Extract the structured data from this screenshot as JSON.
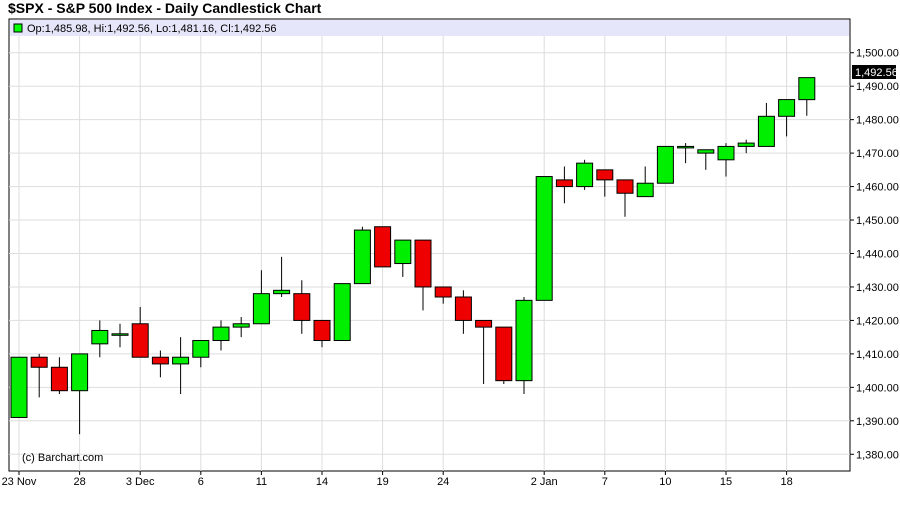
{
  "title": "$SPX - S&P 500 Index - Daily Candlestick Chart",
  "legend": {
    "ohlc_text": "Op:1,485.98, Hi:1,492.56, Lo:1,481.16, Cl:1,492.56",
    "color": "#00ff00"
  },
  "watermark": "(c) Barchart.com",
  "last_price_label": "1,492.56",
  "colors": {
    "up": "#00ee00",
    "down": "#ee0000",
    "legend_band": "#e6e6fa",
    "grid": "#dddddd"
  },
  "chart_data": {
    "type": "candlestick",
    "ylim": [
      1375,
      1505
    ],
    "y_ticks": [
      1380,
      1390,
      1400,
      1410,
      1420,
      1430,
      1440,
      1450,
      1460,
      1470,
      1480,
      1490,
      1500
    ],
    "y_tick_labels": [
      "1,380.00",
      "1,390.00",
      "1,400.00",
      "1,410.00",
      "1,420.00",
      "1,430.00",
      "1,440.00",
      "1,450.00",
      "1,460.00",
      "1,470.00",
      "1,480.00",
      "1,490.00",
      "1,500.00"
    ],
    "x_tick_labels": [
      {
        "index": 0,
        "label": "23 Nov"
      },
      {
        "index": 3,
        "label": "28"
      },
      {
        "index": 6,
        "label": "3 Dec"
      },
      {
        "index": 9,
        "label": "6"
      },
      {
        "index": 12,
        "label": "11"
      },
      {
        "index": 15,
        "label": "14"
      },
      {
        "index": 18,
        "label": "19"
      },
      {
        "index": 21,
        "label": "24"
      },
      {
        "index": 26,
        "label": "2 Jan"
      },
      {
        "index": 29,
        "label": "7"
      },
      {
        "index": 32,
        "label": "10"
      },
      {
        "index": 35,
        "label": "15"
      },
      {
        "index": 38,
        "label": "18"
      }
    ],
    "candles": [
      {
        "o": 1391,
        "h": 1409,
        "l": 1391,
        "c": 1409
      },
      {
        "o": 1409,
        "h": 1410,
        "l": 1397,
        "c": 1406
      },
      {
        "o": 1406,
        "h": 1409,
        "l": 1398,
        "c": 1399
      },
      {
        "o": 1399,
        "h": 1410,
        "l": 1386,
        "c": 1410
      },
      {
        "o": 1413,
        "h": 1420,
        "l": 1409,
        "c": 1417
      },
      {
        "o": 1416,
        "h": 1419,
        "l": 1412,
        "c": 1416
      },
      {
        "o": 1419,
        "h": 1424,
        "l": 1409,
        "c": 1409
      },
      {
        "o": 1409,
        "h": 1411,
        "l": 1403,
        "c": 1407
      },
      {
        "o": 1407,
        "h": 1415,
        "l": 1398,
        "c": 1409
      },
      {
        "o": 1409,
        "h": 1414,
        "l": 1406,
        "c": 1414
      },
      {
        "o": 1414,
        "h": 1420,
        "l": 1411,
        "c": 1418
      },
      {
        "o": 1418,
        "h": 1421,
        "l": 1415,
        "c": 1419
      },
      {
        "o": 1419,
        "h": 1435,
        "l": 1419,
        "c": 1428
      },
      {
        "o": 1428,
        "h": 1439,
        "l": 1427,
        "c": 1429
      },
      {
        "o": 1428,
        "h": 1432,
        "l": 1416,
        "c": 1420
      },
      {
        "o": 1420,
        "h": 1420,
        "l": 1412,
        "c": 1414
      },
      {
        "o": 1414,
        "h": 1431,
        "l": 1414,
        "c": 1431
      },
      {
        "o": 1431,
        "h": 1448,
        "l": 1431,
        "c": 1447
      },
      {
        "o": 1448,
        "h": 1448,
        "l": 1436,
        "c": 1436
      },
      {
        "o": 1437,
        "h": 1444,
        "l": 1433,
        "c": 1444
      },
      {
        "o": 1444,
        "h": 1444,
        "l": 1423,
        "c": 1430
      },
      {
        "o": 1430,
        "h": 1430,
        "l": 1425,
        "c": 1427
      },
      {
        "o": 1427,
        "h": 1429,
        "l": 1416,
        "c": 1420
      },
      {
        "o": 1420,
        "h": 1420,
        "l": 1401,
        "c": 1418
      },
      {
        "o": 1418,
        "h": 1418,
        "l": 1401,
        "c": 1402
      },
      {
        "o": 1402,
        "h": 1427,
        "l": 1398,
        "c": 1426
      },
      {
        "o": 1426,
        "h": 1463,
        "l": 1426,
        "c": 1463
      },
      {
        "o": 1462,
        "h": 1466,
        "l": 1455,
        "c": 1460
      },
      {
        "o": 1460,
        "h": 1468,
        "l": 1459,
        "c": 1467
      },
      {
        "o": 1465,
        "h": 1465,
        "l": 1457,
        "c": 1462
      },
      {
        "o": 1462,
        "h": 1462,
        "l": 1451,
        "c": 1458
      },
      {
        "o": 1457,
        "h": 1466,
        "l": 1457,
        "c": 1461
      },
      {
        "o": 1461,
        "h": 1472,
        "l": 1461,
        "c": 1472
      },
      {
        "o": 1472,
        "h": 1473,
        "l": 1467,
        "c": 1472
      },
      {
        "o": 1470,
        "h": 1471,
        "l": 1465,
        "c": 1471
      },
      {
        "o": 1468,
        "h": 1473,
        "l": 1463,
        "c": 1472
      },
      {
        "o": 1472,
        "h": 1474,
        "l": 1470,
        "c": 1473
      },
      {
        "o": 1472,
        "h": 1485,
        "l": 1472,
        "c": 1481
      },
      {
        "o": 1481,
        "h": 1486,
        "l": 1475,
        "c": 1486
      },
      {
        "o": 1485.98,
        "h": 1492.56,
        "l": 1481.16,
        "c": 1492.56
      }
    ]
  }
}
